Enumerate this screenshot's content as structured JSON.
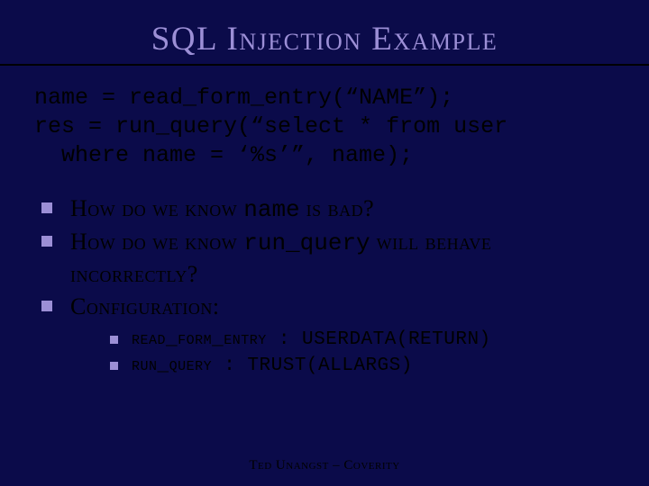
{
  "title": "SQL Injection Example",
  "code": {
    "line1": "name = read_form_entry(“NAME”);",
    "line2": "res = run_query(“select * from user",
    "line3": "  where name = ‘%s’”, name);"
  },
  "bullets": {
    "b1_pre": "How do we know ",
    "b1_code": "name",
    "b1_post": " is bad?",
    "b2_pre": "How do we know ",
    "b2_code": "run_query",
    "b2_post": " will behave incorrectly?",
    "b3": "Configuration:"
  },
  "sub": {
    "s1": "read_form_entry : USERDATA(RETURN)",
    "s2": "run_query : TRUST(ALLARGS)"
  },
  "footer": "Ted Unangst – Coverity"
}
